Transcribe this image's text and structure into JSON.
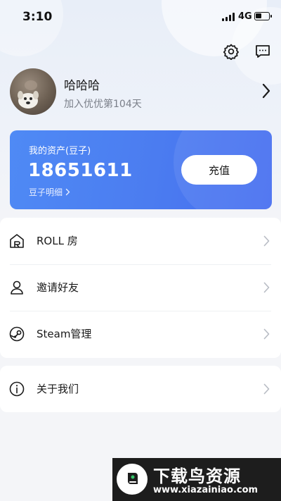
{
  "status_bar": {
    "time": "3:10",
    "network": "4G"
  },
  "header": {
    "settings_icon": "gear-icon",
    "message_icon": "chat-bubble-icon"
  },
  "profile": {
    "username": "哈哈哈",
    "join_days": "加入优优第104天"
  },
  "asset_card": {
    "label": "我的资产(豆子)",
    "value": "18651611",
    "detail_link": "豆子明细",
    "recharge_label": "充值",
    "colors": {
      "gradient_start": "#4f8af5",
      "gradient_end": "#456df0"
    }
  },
  "menu": {
    "items": [
      {
        "label": "ROLL 房",
        "icon": "roll-room-icon"
      },
      {
        "label": "邀请好友",
        "icon": "user-icon"
      },
      {
        "label": "Steam管理",
        "icon": "steam-icon"
      }
    ],
    "secondary": [
      {
        "label": "关于我们",
        "icon": "info-icon"
      }
    ]
  },
  "watermark": {
    "title": "下载鸟资源",
    "url": "www.xiazainiao.com"
  }
}
